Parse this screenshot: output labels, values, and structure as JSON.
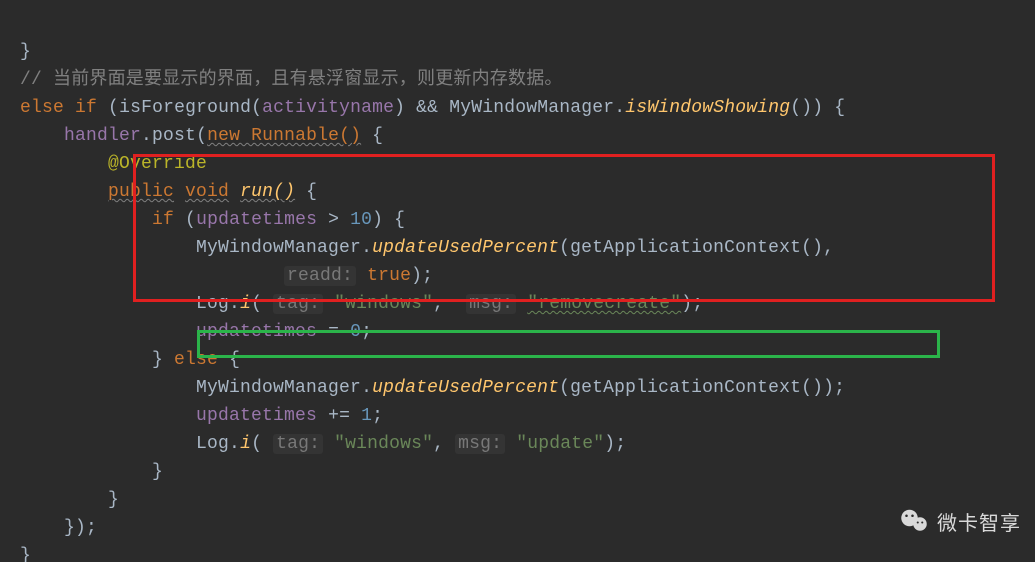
{
  "l1": "}",
  "l2_comment": "// 当前界面是要显示的界面，且有悬浮窗显示，则更新内存数据。",
  "l3": {
    "else": "else",
    "if": "if",
    "foreground": "isForeground",
    "param": "activityname",
    "amp": "&&",
    "mwm": "MyWindowManager",
    "isshow": "isWindowShowing",
    "tail": "()) {"
  },
  "l4": {
    "handler": "handler",
    "post": "post",
    "newRun": "new Runnable()",
    "brace": " {"
  },
  "l5": "@Override",
  "l6": {
    "public": "public",
    "void": "void",
    "run": "run()",
    "brace": " {"
  },
  "l7": {
    "if": "if",
    "upd": "updatetimes",
    "gt": " > ",
    "ten": "10",
    "brace": ") {"
  },
  "l8": {
    "mwm": "MyWindowManager",
    "method": "updateUsedPercent",
    "getctx": "getApplicationContext(),"
  },
  "l9": {
    "plabel": "readd:",
    "true": "true",
    "tail": ");"
  },
  "l10": {
    "log": "Log",
    "i": "i",
    "ptag": "tag:",
    "windows": "\"windows\"",
    "pmsg": "msg:",
    "remove": "\"removecreate\"",
    "tail": ");"
  },
  "l11": {
    "upd": "updatetimes",
    "eq": " = ",
    "zero": "0",
    "semi": ";"
  },
  "l12": {
    "brace": "} ",
    "else": "else",
    "brace2": " {"
  },
  "l13": {
    "mwm": "MyWindowManager",
    "method": "updateUsedPercent",
    "getctx": "getApplicationContext());"
  },
  "l14": {
    "upd": "updatetimes",
    "pe": " += ",
    "one": "1",
    "semi": ";"
  },
  "l15": {
    "log": "Log",
    "i": "i",
    "ptag": "tag:",
    "windows": "\"windows\"",
    "pmsg": "msg:",
    "update": "\"update\"",
    "tail": ");"
  },
  "l16": "}",
  "l17": "}",
  "l18": "});",
  "l19": "}",
  "watermark_text": "微卡智享"
}
